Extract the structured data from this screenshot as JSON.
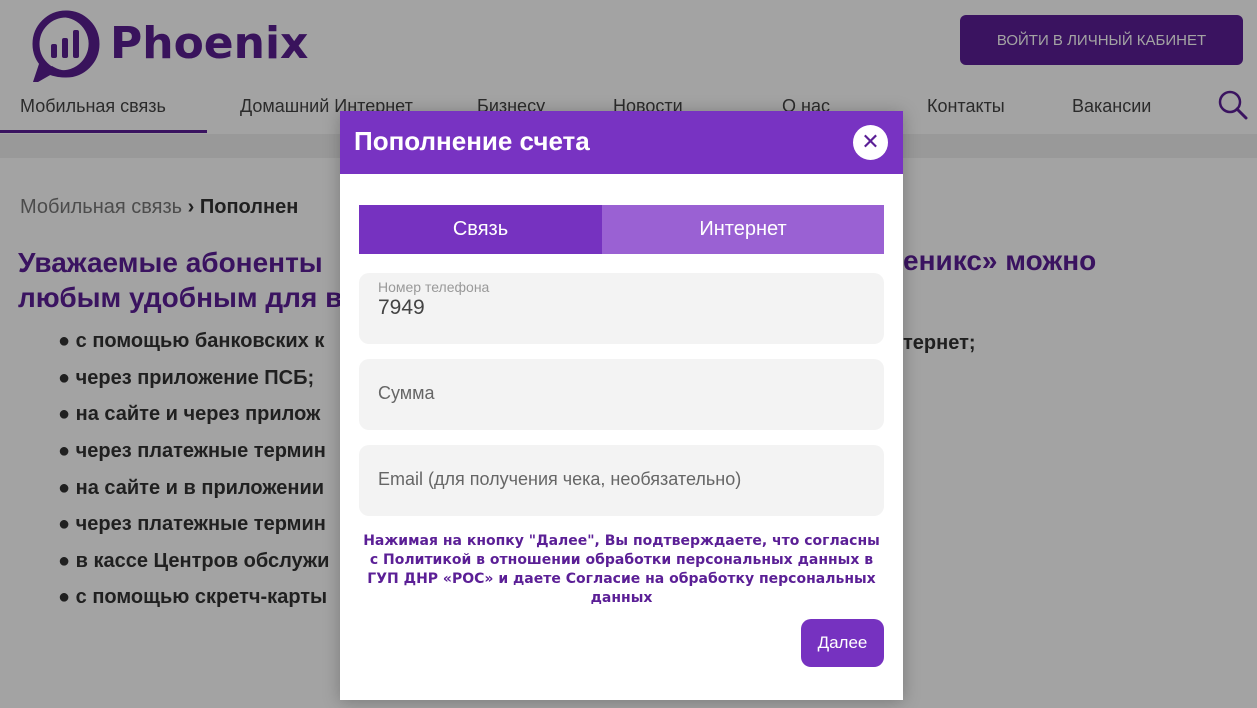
{
  "header": {
    "logo_text": "Phoenix",
    "login_button": "ВОЙТИ В ЛИЧНЫЙ КАБИНЕТ",
    "nav": [
      {
        "label": "Мобильная связь"
      },
      {
        "label": "Домашний Интернет"
      },
      {
        "label": "Бизнесу"
      },
      {
        "label": "Новости"
      },
      {
        "label": "О нас"
      },
      {
        "label": "Контакты"
      },
      {
        "label": "Вакансии"
      }
    ],
    "search_icon": "search-icon"
  },
  "page": {
    "breadcrumb_root": "Мобильная связь",
    "breadcrumb_current": "› Пополнен",
    "headline_left": "Уважаемые абоненты\nлюбым удобным для в",
    "headline_right": "еникс» можно",
    "list": [
      "● с помощью банковских к",
      "● через приложение ПСБ;",
      "● на сайте и через прилож",
      "● через платежные термин",
      "● на сайте и в приложении",
      "● через платежные термин",
      "● в кассе Центров обслужи",
      "● с помощью скретч-карты"
    ],
    "list_right_fragment": "тернет;"
  },
  "modal": {
    "title": "Пополнение счета",
    "close_icon": "close-icon",
    "tabs": [
      {
        "label": "Связь",
        "active": true
      },
      {
        "label": "Интернет",
        "active": false
      }
    ],
    "phone": {
      "label": "Номер телефона",
      "value": "7949"
    },
    "amount": {
      "placeholder": "Сумма"
    },
    "email": {
      "placeholder": "Email (для получения чека, необязательно)"
    },
    "consent_text": "Нажимая на кнопку \"Далее\", Вы подтверждаете, что согласны с Политикой в отношении обработки персональных данных в ГУП ДНР «РОС» и даете Согласие на обработку персональных данных",
    "next_button": "Далее"
  },
  "colors": {
    "brand": "#5b1f96",
    "modal_header": "#7833c2",
    "tab_active": "#7632c0",
    "tab_inactive": "#9a61d3"
  }
}
